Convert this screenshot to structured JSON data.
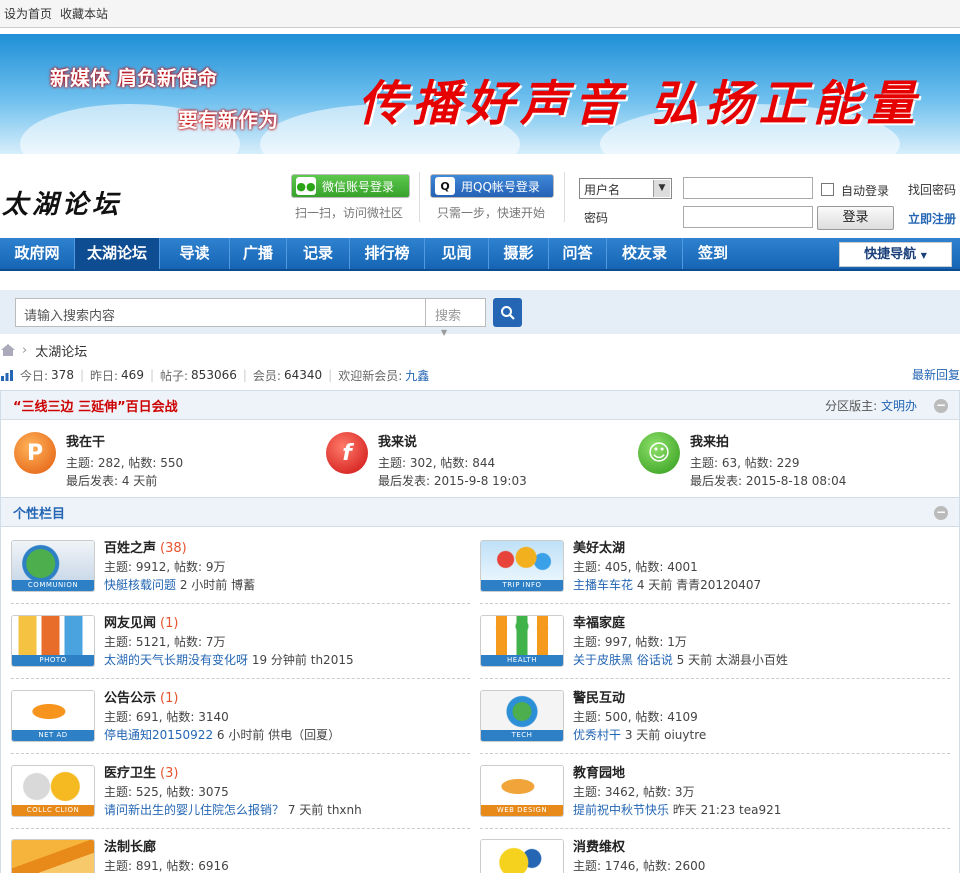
{
  "topbar": {
    "set_home": "设为首页",
    "bookmark": "收藏本站"
  },
  "banner": {
    "line1": "新媒体  肩负新使命",
    "line2": "要有新作为",
    "slogan": "传播好声音 弘扬正能量"
  },
  "logo": {
    "text": "太湖论坛"
  },
  "login": {
    "wechat_label": "微信账号登录",
    "wechat_sub": "扫一扫，访问微社区",
    "qq_label": "用QQ帐号登录",
    "qq_sub": "只需一步，快速开始",
    "user_select": "用户名",
    "password_label": "密码",
    "auto_login": "自动登录",
    "login_button": "登录",
    "find_password": "找回密码",
    "register": "立即注册"
  },
  "nav": {
    "items": [
      "政府网",
      "太湖论坛",
      "导读",
      "广播",
      "记录",
      "排行榜",
      "见闻",
      "摄影",
      "问答",
      "校友录",
      "签到"
    ],
    "active": "太湖论坛",
    "quick_nav": "快捷导航"
  },
  "search": {
    "placeholder": "请输入搜索内容",
    "type": "搜索"
  },
  "breadcrumb": {
    "current": "太湖论坛"
  },
  "stats": {
    "today_label": "今日:",
    "today": "378",
    "yesterday_label": "昨日:",
    "yesterday": "469",
    "posts_label": "帖子:",
    "posts": "853066",
    "members_label": "会员:",
    "members": "64340",
    "welcome_label": "欢迎新会员:",
    "new_member": "九鑫",
    "latest_reply": "最新回复"
  },
  "section1": {
    "title": "“三线三边 三延伸”百日会战",
    "moderator_label": "分区版主:",
    "moderator": "文明办",
    "forums": [
      {
        "name": "我在干",
        "stats": "主题: 282, 帖数: 550",
        "last": "最后发表: 4 天前"
      },
      {
        "name": "我来说",
        "stats": "主题: 302, 帖数: 844",
        "last": "最后发表: 2015-9-8 19:03"
      },
      {
        "name": "我来拍",
        "stats": "主题: 63, 帖数: 229",
        "last": "最后发表: 2015-8-18 08:04"
      }
    ]
  },
  "section2": {
    "title": "个性栏目",
    "forums": [
      {
        "name": "百姓之声",
        "count": "(38)",
        "stats": "主题: 9912, 帖数: 9万",
        "link": "快艇核载问题",
        "meta": "2 小时前  博蓄",
        "tag": "COMMUNION"
      },
      {
        "name": "美好太湖",
        "count": "",
        "stats": "主题: 405, 帖数: 4001",
        "link": "主播车车花",
        "meta": "4 天前  青青20120407",
        "tag": "TRIP INFO"
      },
      {
        "name": "网友见闻",
        "count": "(1)",
        "stats": "主题: 5121, 帖数: 7万",
        "link": "太湖的天气长期没有变化呀",
        "meta": "19 分钟前  th2015",
        "tag": "PHOTO"
      },
      {
        "name": "幸福家庭",
        "count": "",
        "stats": "主题: 997, 帖数: 1万",
        "link": "关于皮肤黑  俗话说",
        "meta": "5 天前  太湖县小百姓",
        "tag": "HEALTH"
      },
      {
        "name": "公告公示",
        "count": "(1)",
        "stats": "主题: 691, 帖数: 3140",
        "link": "停电通知20150922",
        "meta": "6 小时前  供电（回夏）",
        "tag": "NET AD"
      },
      {
        "name": "警民互动",
        "count": "",
        "stats": "主题: 500, 帖数: 4109",
        "link": "优秀村干",
        "meta": "3 天前  oiuytre",
        "tag": "TECH"
      },
      {
        "name": "医疗卫生",
        "count": "(3)",
        "stats": "主题: 525, 帖数: 3075",
        "link": "请问新出生的婴儿住院怎么报销？",
        "meta": "7 天前  thxnh",
        "tag": "COLLC CLION"
      },
      {
        "name": "教育园地",
        "count": "",
        "stats": "主题: 3462, 帖数: 3万",
        "link": "提前祝中秋节快乐",
        "meta": "昨天 21:23  tea921",
        "tag": "WEB DESIGN"
      },
      {
        "name": "法制长廊",
        "count": "",
        "stats": "主题: 891, 帖数: 6916",
        "link": "",
        "meta": "",
        "tag": ""
      },
      {
        "name": "消费维权",
        "count": "",
        "stats": "主题: 1746, 帖数: 2600",
        "link": "",
        "meta": "",
        "tag": ""
      }
    ]
  }
}
